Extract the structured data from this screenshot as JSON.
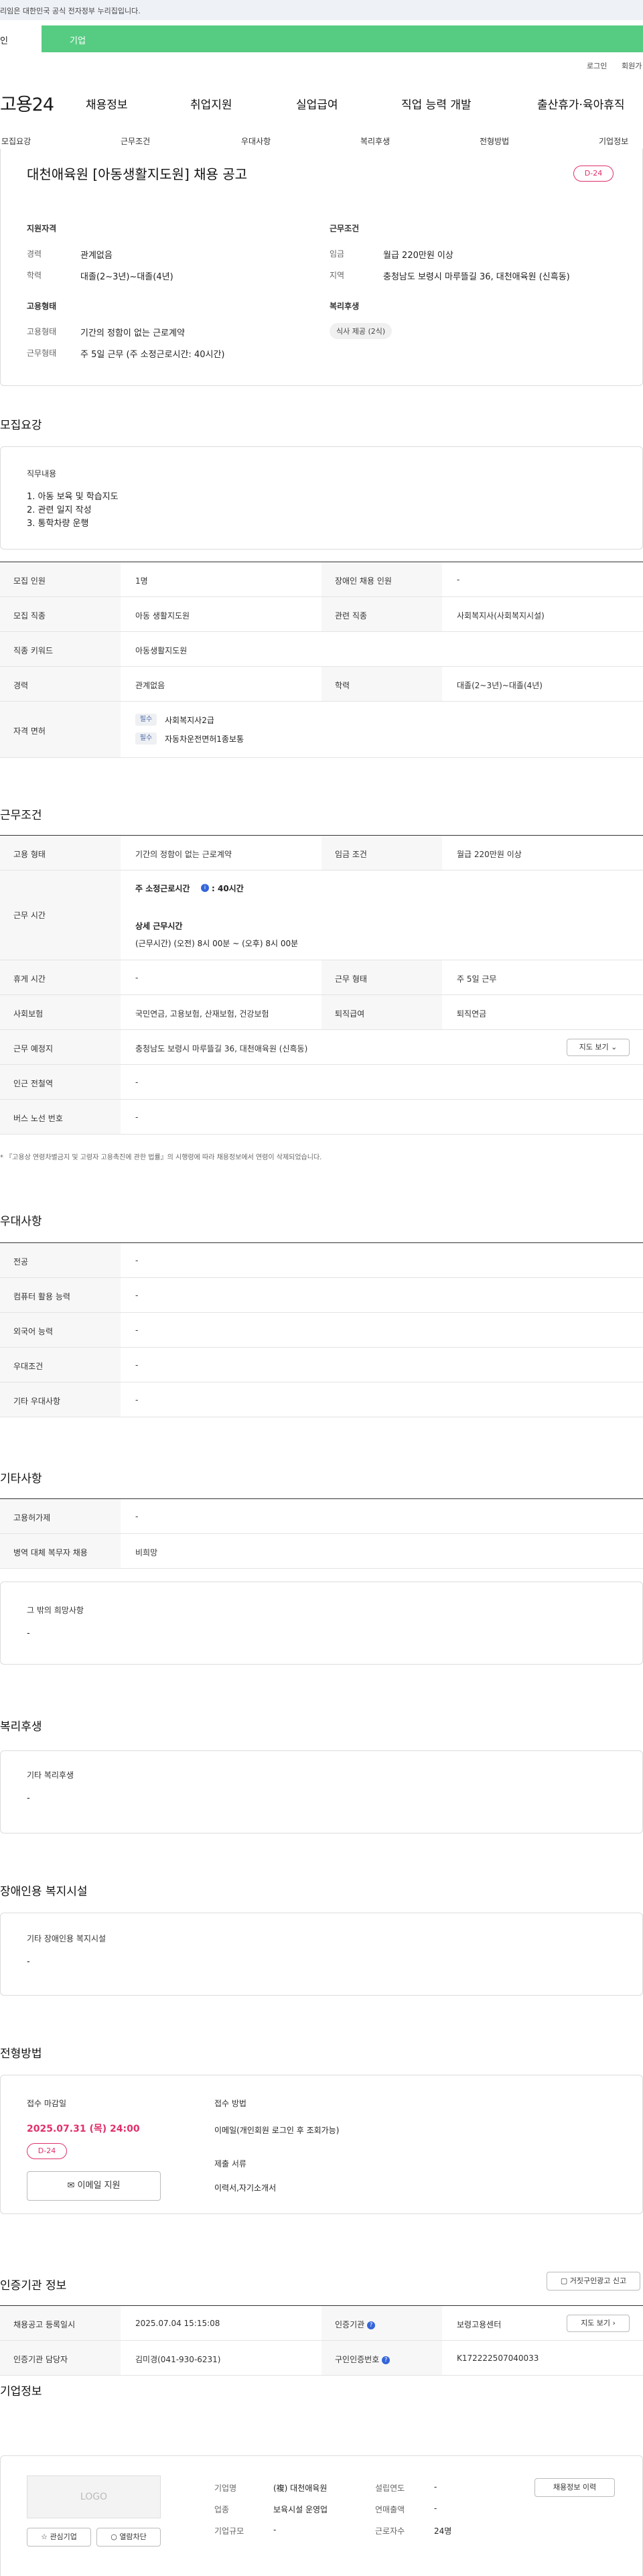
{
  "gov_banner": "리임은 대한민국 공식 전자정부 누리집입니다.",
  "top_tabs": {
    "first": "인",
    "second": "기업"
  },
  "util": {
    "login": "로그인",
    "join": "회원가"
  },
  "logo": "고용24",
  "gnb": [
    "채용정보",
    "취업지원",
    "실업급여",
    "직업 능력 개발",
    "출산휴가·육아휴직"
  ],
  "subnav": [
    "모집요강",
    "근무조건",
    "우대사항",
    "복리후생",
    "전형방법",
    "기업정보"
  ],
  "title": "대천애육원 [아동생활지도원] 채용 공고",
  "dday": "D-24",
  "summary": {
    "qual_title": "지원자격",
    "qual": [
      {
        "k": "경력",
        "v": "관계없음"
      },
      {
        "k": "학력",
        "v": "대졸(2~3년)~대졸(4년)"
      }
    ],
    "emp_title": "고용형태",
    "emp": [
      {
        "k": "고용형태",
        "v": "기간의 정함이 없는 근로계약"
      },
      {
        "k": "근무형태",
        "v": "주 5일 근무 (주 소정근로시간: 40시간)"
      }
    ],
    "cond_title": "근무조건",
    "cond": [
      {
        "k": "임금",
        "v": "월급 220만원 이상"
      },
      {
        "k": "지역",
        "v": "충청남도 보령시 마루뜰길 36, 대천애육원 (신흑동)"
      }
    ],
    "welfare_title": "복리후생",
    "welfare_tag": "식사 제공 (2식)"
  },
  "recruit": {
    "title": "모집요강",
    "duty_title": "직무내용",
    "duties": [
      "1. 아동 보육 및 학습지도",
      "2. 관련 일지 작성",
      "3. 통학차량 운행"
    ],
    "rows": [
      {
        "k1": "모집 인원",
        "v1": "1명",
        "k2": "장애인 채용 인원",
        "v2": "-"
      },
      {
        "k1": "모집 직종",
        "v1": "아동 생활지도원",
        "k2": "관련 직종",
        "v2": "사회복지사(사회복지시설)"
      },
      {
        "k1": "직종 키워드",
        "v1": "아동생활지도원"
      },
      {
        "k1": "경력",
        "v1": "관계없음",
        "k2": "학력",
        "v2": "대졸(2~3년)~대졸(4년)"
      }
    ],
    "license_k": "자격 면허",
    "licenses": [
      {
        "tag": "필수",
        "name": "사회복지사2급"
      },
      {
        "tag": "필수",
        "name": "자동차운전면허1종보통"
      }
    ]
  },
  "work": {
    "title": "근무조건",
    "type_k": "고용 형태",
    "type_v": "기간의 정함이 없는 근로계약",
    "wage_k": "임금 조건",
    "wage_v": "월급 220만원 이상",
    "hours_k": "근무 시간",
    "hours_main": "주 소정근로시간",
    "hours_main_v": ": 40시간",
    "hours_detail_title": "상세 근무시간",
    "hours_detail": "(근무시간) (오전) 8시 00분 ~ (오후) 8시 00분",
    "rest_k": "휴게 시간",
    "rest_v": "-",
    "form_k": "근무 형태",
    "form_v": "주 5일 근무",
    "ins_k": "사회보험",
    "ins_v": "국민연금, 고용보험, 산재보험, 건강보험",
    "ret_k": "퇴직급여",
    "ret_v": "퇴직연금",
    "place_k": "근무 예정지",
    "place_v": "충청남도 보령시 마루뜰길 36, 대천애육원 (신흑동)",
    "map_btn": "지도 보기 ⌄",
    "subway_k": "인근 전철역",
    "subway_v": "-",
    "bus_k": "버스 노선 번호",
    "bus_v": "-",
    "notice": "* 『고용상 연령차별금지 및 고령자 고용촉진에 관한 법률』의 시행령에 따라 채용정보에서 연령이 삭제되었습니다."
  },
  "pref": {
    "title": "우대사항",
    "rows": [
      {
        "k": "전공",
        "v": "-"
      },
      {
        "k": "컴퓨터 활용 능력",
        "v": "-"
      },
      {
        "k": "외국어 능력",
        "v": "-"
      },
      {
        "k": "우대조건",
        "v": "-"
      },
      {
        "k": "기타 우대사항",
        "v": "-"
      }
    ]
  },
  "etc": {
    "title": "기타사항",
    "rows": [
      {
        "k": "고용허가제",
        "v": "-"
      },
      {
        "k": "병역 대체 복무자 채용",
        "v": "비희망"
      }
    ],
    "other_title": "그 밖의 희망사항",
    "other_v": "-"
  },
  "welfare": {
    "title": "복리후생",
    "box_title": "기타 복리후생",
    "box_v": "-"
  },
  "disabled": {
    "title": "장애인용 복지시설",
    "box_title": "기타 장애인용 복지시설",
    "box_v": "-"
  },
  "process": {
    "title": "전형방법",
    "deadline_k": "접수 마감일",
    "deadline_v": "2025.07.31 (목) 24:00",
    "dday": "D-24",
    "email_btn": "이메일 지원",
    "method_k": "접수 방법",
    "method_v": "이메일(개인회원 로그인 후 조회가능)",
    "docs_k": "제출 서류",
    "docs_v": "이력서,자기소개서"
  },
  "cert": {
    "title": "인증기관 정보",
    "report_btn": "거짓구인광고 신고",
    "reg_k": "채용공고 등록일시",
    "reg_v": "2025.07.04 15:15:08",
    "inst_k": "인증기관",
    "inst_v": "보령고용센터",
    "map_btn": "지도 보기 ›",
    "staff_k": "인증기관 담당자",
    "staff_v": "김미경(041-930-6231)",
    "auth_k": "구인인증번호",
    "auth_v": "K172222507040033"
  },
  "company": {
    "title": "기업정보",
    "logo_text": "LOGO",
    "fav_btn": "관심기업",
    "block_btn": "열람차단",
    "name_k": "기업명",
    "name_v": "(複) 대천애육원",
    "year_k": "설립연도",
    "year_v": "-",
    "ind_k": "업종",
    "ind_v": "보육시설 운영업",
    "sales_k": "연매출액",
    "sales_v": "-",
    "size_k": "기업규모",
    "size_v": "-",
    "emp_k": "근로자수",
    "emp_v": "24명",
    "history_btn": "채용정보 이력"
  }
}
